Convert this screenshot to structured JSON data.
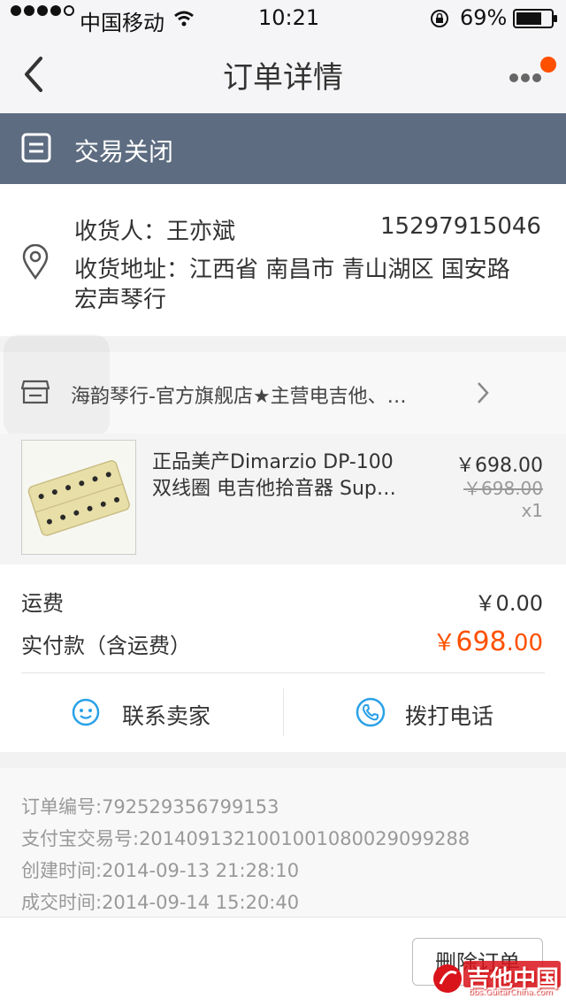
{
  "status_bar": {
    "carrier": "中国移动",
    "time": "10:21",
    "battery": "69%"
  },
  "nav": {
    "title": "订单详情",
    "back_icon": "chevron-left-icon",
    "more_icon": "more-icon"
  },
  "order_status": {
    "text": "交易关闭",
    "icon": "receipt-icon",
    "bg_color": "#5d6c80"
  },
  "address": {
    "recipient_label": "收货人：王亦斌",
    "phone": "15297915046",
    "address_line1": "收货地址：江西省 南昌市 青山湖区 国安路",
    "address_line2": "宏声琴行"
  },
  "shop": {
    "name": "海韵琴行-官方旗舰店★主营电吉他、…"
  },
  "product": {
    "title_line1": "正品美产Dimarzio DP-100",
    "title_line2": "双线圈 电吉他拾音器 Sup…",
    "price": "￥698.00",
    "original_price": "￥698.00",
    "quantity": "x1"
  },
  "fees": {
    "shipping_label": "运费",
    "shipping_value": "￥0.00",
    "total_label": "实付款（含运费）",
    "total_currency": "￥",
    "total_int": "698",
    "total_dec": ".00",
    "accent_color": "#ff5000"
  },
  "actions": {
    "contact_seller": "联系卖家",
    "call_phone": "拨打电话"
  },
  "order_info": {
    "order_no": "订单编号:792529356799153",
    "alipay_no": "支付宝交易号:2014091321001001080029099288",
    "created": "创建时间:2014-09-13 21:28:10",
    "completed": "成交时间:2014-09-14 15:20:40"
  },
  "footer": {
    "delete_button": "删除订单"
  },
  "watermark": {
    "name": "吉他中国",
    "url": "bbs.GuitarChina.com"
  }
}
